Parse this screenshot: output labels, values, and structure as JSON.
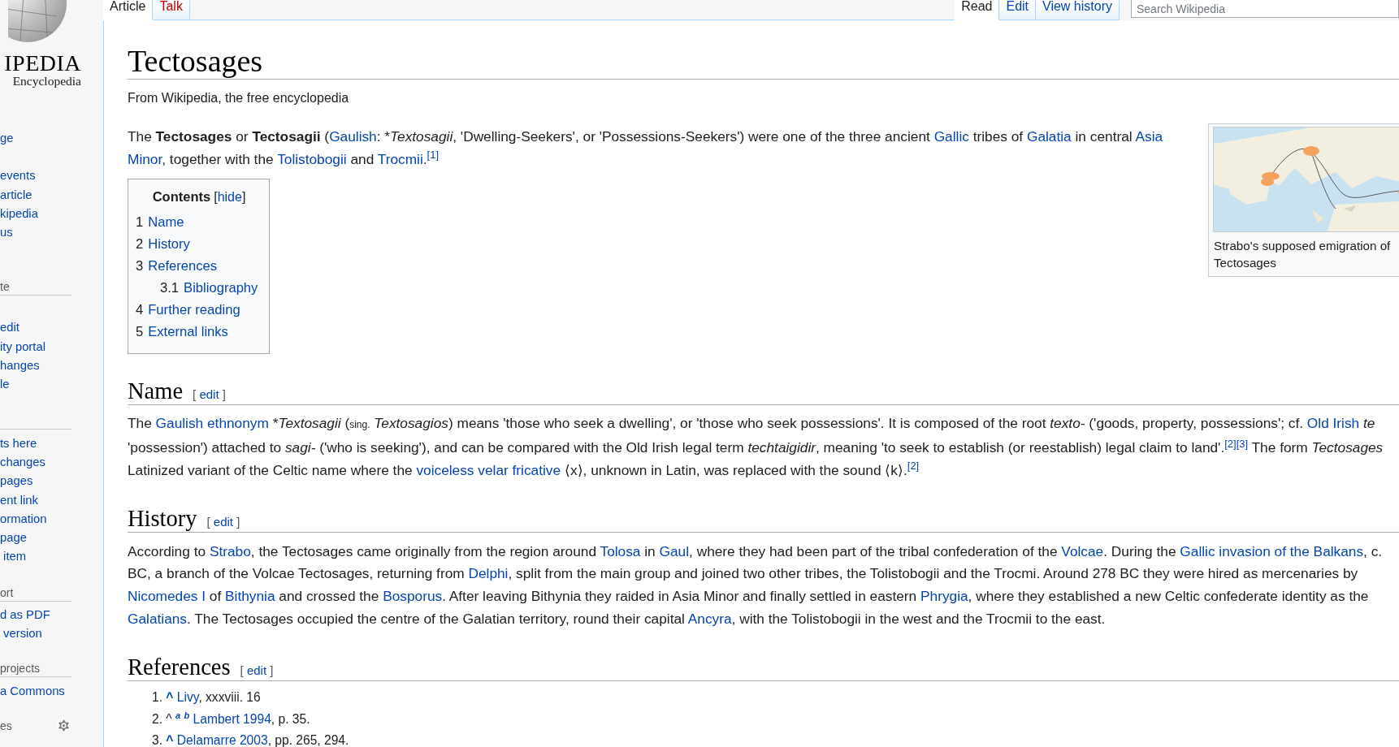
{
  "sidebar": {
    "logo": {
      "wordmark": "IPEDIA",
      "tagline": "Encyclopedia"
    },
    "sections": [
      {
        "ruled": false,
        "items": [
          "ge"
        ]
      },
      {
        "ruled": false,
        "items": [
          "events",
          "article",
          "kipedia",
          "us"
        ]
      },
      {
        "ruled": true,
        "heading": "te",
        "settings": false,
        "items": [
          "edit",
          "ity portal",
          "hanges",
          "le"
        ]
      },
      {
        "ruled": true,
        "items": [
          "ts here",
          "changes",
          "pages",
          "ent link",
          "ormation",
          "page",
          " item"
        ]
      },
      {
        "ruled": true,
        "heading": "ort",
        "settings": false,
        "items": [
          "d as PDF",
          " version"
        ]
      },
      {
        "ruled": true,
        "heading": "projects",
        "settings": false,
        "items": [
          "a Commons"
        ]
      },
      {
        "ruled": false,
        "heading": "es",
        "settings": true
      }
    ]
  },
  "tabs": {
    "left": [
      {
        "label": "Article",
        "selected": true
      },
      {
        "label": "Talk",
        "selected": false
      }
    ],
    "right": [
      {
        "label": "Read",
        "selected": true
      },
      {
        "label": "Edit",
        "selected": false
      },
      {
        "label": "View history",
        "selected": false
      }
    ]
  },
  "search": {
    "placeholder": "Search Wikipedia"
  },
  "title": "Tectosages",
  "tagline": "From Wikipedia, the free encyclopedia",
  "intro": [
    [
      {
        "kind": "text",
        "t": "The **Tectosages** or **Tectosagii** ("
      },
      {
        "kind": "link",
        "t": "Gaulish"
      },
      {
        "kind": "text",
        "t": ": *"
      },
      {
        "kind": "text",
        "t": "*Textosagii*, 'Dwelling-Seekers', or 'Possessions-Seekers') were one of the three ancient "
      },
      {
        "kind": "link",
        "t": "Gallic"
      },
      {
        "kind": "text",
        "t": " tribes of "
      },
      {
        "kind": "link",
        "t": "Galatia"
      },
      {
        "kind": "text",
        "t": " in central "
      },
      {
        "kind": "link",
        "t": "Asia"
      }
    ],
    [
      {
        "kind": "link",
        "t": "Minor"
      },
      {
        "kind": "text",
        "t": ", together with the "
      },
      {
        "kind": "link",
        "t": "Tolistobogii"
      },
      {
        "kind": "text",
        "t": " and "
      },
      {
        "kind": "link",
        "t": "Trocmii"
      },
      {
        "kind": "text",
        "t": ".$^{[1]}$"
      }
    ]
  ],
  "contents": {
    "title": "Contents",
    "hide": {
      "open": "[",
      "label": "hide",
      "close": "]"
    },
    "items": [
      {
        "number": "1",
        "label": "Name"
      },
      {
        "number": "2",
        "label": "History"
      },
      {
        "number": "3",
        "label": "References",
        "children": [
          {
            "number": "3.1",
            "label": "Bibliography"
          }
        ]
      },
      {
        "number": "4",
        "label": "Further reading"
      },
      {
        "number": "5",
        "label": "External links"
      }
    ]
  },
  "infobox": {
    "image": {
      "kind": "picture"
    },
    "caption": [
      "Strabo's supposed emigration of",
      "Tectosages"
    ]
  },
  "sections": [
    {
      "heading": "Name",
      "edit": {
        "open": "[",
        "label": "edit",
        "close": "]"
      },
      "lines": [
        [
          {
            "kind": "text",
            "t": "The "
          },
          {
            "kind": "link",
            "t": "Gaulish ethnonym"
          },
          {
            "kind": "text",
            "t": " *"
          },
          {
            "kind": "text",
            "t": "*Textosagii* ("
          },
          {
            "kind": "small",
            "t": "sing."
          },
          {
            "kind": "text",
            "t": " *Textosagios*) means 'those who seek a dwelling', or 'those who seek possessions'. It is composed of the root *texto-* ('goods, property, possessions'; cf. "
          },
          {
            "kind": "link",
            "t": "Old Irish"
          },
          {
            "kind": "text",
            "t": " *te*"
          }
        ],
        [
          {
            "kind": "text",
            "t": "'possession') attached to *sagi-* ('who is seeking'), and can be compared with the Old Irish legal term *techtaigidir*, meaning 'to seek to establish (or reestablish) legal claim to land'."
          },
          {
            "kind": "link",
            "t": "$^{[2][3]}$"
          },
          {
            "kind": "text",
            "t": " The form *Tectosages*"
          }
        ],
        [
          {
            "kind": "text",
            "t": "Latinized variant of the Celtic name where the "
          },
          {
            "kind": "link",
            "t": "voiceless velar fricative"
          },
          {
            "kind": "text",
            "t": " ⟨x⟩, unknown in Latin, was replaced with the sound ⟨k⟩."
          },
          {
            "kind": "link",
            "t": "$^{[2]}$"
          }
        ]
      ]
    },
    {
      "heading": "History",
      "edit": {
        "open": "[",
        "label": "edit",
        "close": "]"
      },
      "lines": [
        [
          {
            "kind": "text",
            "t": "According to "
          },
          {
            "kind": "link",
            "t": "Strabo"
          },
          {
            "kind": "text",
            "t": ", the Tectosages came originally from the region around "
          },
          {
            "kind": "link",
            "t": "Tolosa"
          },
          {
            "kind": "text",
            "t": " in "
          },
          {
            "kind": "link",
            "t": "Gaul"
          },
          {
            "kind": "text",
            "t": ", where they had been part of the tribal confederation of the "
          },
          {
            "kind": "link",
            "t": "Volcae"
          },
          {
            "kind": "text",
            "t": ". During the "
          },
          {
            "kind": "link",
            "t": "Gallic invasion of the Balkans"
          },
          {
            "kind": "text",
            "t": ", c."
          }
        ],
        [
          {
            "kind": "text",
            "t": "BC, a branch of the Volcae Tectosages, returning from "
          },
          {
            "kind": "link",
            "t": "Delphi"
          },
          {
            "kind": "text",
            "t": ", split from the main group and joined two other tribes, the Tolistobogii and the Trocmi. Around 278 BC they were hired as mercenaries by"
          }
        ],
        [
          {
            "kind": "link",
            "t": "Nicomedes I"
          },
          {
            "kind": "text",
            "t": " of "
          },
          {
            "kind": "link",
            "t": "Bithynia"
          },
          {
            "kind": "text",
            "t": " and crossed the "
          },
          {
            "kind": "link",
            "t": "Bosporus"
          },
          {
            "kind": "text",
            "t": ". After leaving Bithynia they raided in Asia Minor and finally settled in eastern "
          },
          {
            "kind": "link",
            "t": "Phrygia"
          },
          {
            "kind": "text",
            "t": ", where they established a new Celtic confederate identity as the"
          }
        ],
        [
          {
            "kind": "link",
            "t": "Galatians"
          },
          {
            "kind": "text",
            "t": ". The Tectosages occupied the centre of the Galatian territory, round their capital "
          },
          {
            "kind": "link",
            "t": "Ancyra"
          },
          {
            "kind": "text",
            "t": ", with the Tolistobogii in the west and the Trocmii to the east."
          }
        ]
      ]
    }
  ],
  "references": {
    "heading": "References",
    "edit": {
      "open": "[",
      "label": "edit",
      "close": "]"
    },
    "items": [
      {
        "number": "1.",
        "parts": [
          {
            "kind": "link",
            "t": "**^**"
          },
          {
            "kind": "link",
            "t": "Livy"
          },
          {
            "kind": "text",
            "t": ", xxxviii. 16"
          }
        ]
      },
      {
        "number": "2.",
        "parts": [
          {
            "kind": "text",
            "t": "^"
          },
          {
            "kind": "backlink",
            "t": "a"
          },
          {
            "kind": "backlink",
            "t": "b"
          },
          {
            "kind": "link",
            "t": "Lambert 1994"
          },
          {
            "kind": "text",
            "t": ", p. 35."
          }
        ]
      },
      {
        "number": "3.",
        "parts": [
          {
            "kind": "link",
            "t": "**^**"
          },
          {
            "kind": "link",
            "t": "Delamarre 2003"
          },
          {
            "kind": "text",
            "t": ", pp. 265, 294."
          }
        ]
      }
    ]
  }
}
